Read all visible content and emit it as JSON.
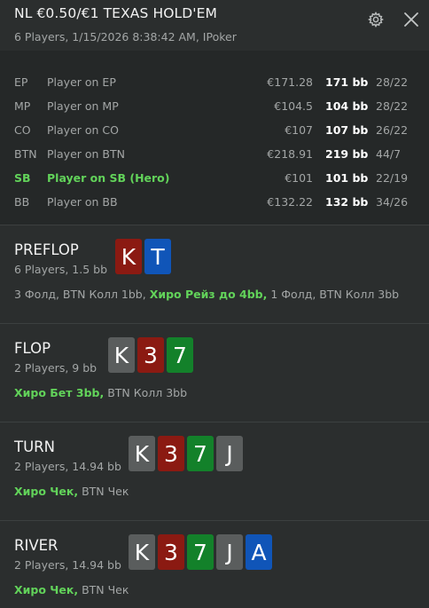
{
  "header": {
    "title": "NL €0.50/€1 TEXAS HOLD'EM",
    "subtitle": "6 Players, 1/15/2026 8:38:42 AM, IPoker",
    "icons": {
      "settings": "gear-icon",
      "close": "close-icon"
    }
  },
  "players": [
    {
      "pos": "EP",
      "name": "Player on EP",
      "stack": "€171.28",
      "bb": "171 bb",
      "stat": "28/22",
      "hero": false
    },
    {
      "pos": "MP",
      "name": "Player on MP",
      "stack": "€104.5",
      "bb": "104 bb",
      "stat": "28/22",
      "hero": false
    },
    {
      "pos": "CO",
      "name": "Player on CO",
      "stack": "€107",
      "bb": "107 bb",
      "stat": "26/22",
      "hero": false
    },
    {
      "pos": "BTN",
      "name": "Player on BTN",
      "stack": "€218.91",
      "bb": "219 bb",
      "stat": "44/7",
      "hero": false
    },
    {
      "pos": "SB",
      "name": "Player on SB (Hero)",
      "stack": "€101",
      "bb": "101 bb",
      "stat": "22/19",
      "hero": true
    },
    {
      "pos": "BB",
      "name": "Player on BB",
      "stack": "€132.22",
      "bb": "132 bb",
      "stat": "34/26",
      "hero": false
    }
  ],
  "streets": [
    {
      "name": "PREFLOP",
      "info": "6 Players, 1.5 bb",
      "cards": [
        {
          "rank": "K",
          "color": "red"
        },
        {
          "rank": "T",
          "color": "blue"
        }
      ],
      "actions": [
        {
          "text": "3 Фолд, BTN Колл 1bb, ",
          "hero": false
        },
        {
          "text": "Хиро Рейз до 4bb,",
          "hero": true
        },
        {
          "text": " 1 Фолд, BTN Колл 3bb",
          "hero": false
        }
      ]
    },
    {
      "name": "FLOP",
      "info": "2 Players, 9 bb",
      "cards": [
        {
          "rank": "K",
          "color": "gray"
        },
        {
          "rank": "3",
          "color": "red"
        },
        {
          "rank": "7",
          "color": "green"
        }
      ],
      "actions": [
        {
          "text": "Хиро Бет 3bb,",
          "hero": true
        },
        {
          "text": " BTN Колл 3bb",
          "hero": false
        }
      ]
    },
    {
      "name": "TURN",
      "info": "2 Players, 14.94 bb",
      "cards": [
        {
          "rank": "K",
          "color": "gray"
        },
        {
          "rank": "3",
          "color": "red"
        },
        {
          "rank": "7",
          "color": "green"
        },
        {
          "rank": "J",
          "color": "gray"
        }
      ],
      "actions": [
        {
          "text": "Хиро Чек,",
          "hero": true
        },
        {
          "text": " BTN Чек",
          "hero": false
        }
      ]
    },
    {
      "name": "RIVER",
      "info": "2 Players, 14.94 bb",
      "cards": [
        {
          "rank": "K",
          "color": "gray"
        },
        {
          "rank": "3",
          "color": "red"
        },
        {
          "rank": "7",
          "color": "green"
        },
        {
          "rank": "J",
          "color": "gray"
        },
        {
          "rank": "A",
          "color": "blue"
        }
      ],
      "actions": [
        {
          "text": "Хиро Чек,",
          "hero": true
        },
        {
          "text": " BTN Чек",
          "hero": false
        }
      ]
    }
  ],
  "colors": {
    "background": "#2b2e2e",
    "players_bg": "#252828",
    "hero_green": "#62d35a",
    "card_red": "#8b1a12",
    "card_blue": "#1055b8",
    "card_gray": "#5a5d5d",
    "card_green": "#13812a"
  }
}
